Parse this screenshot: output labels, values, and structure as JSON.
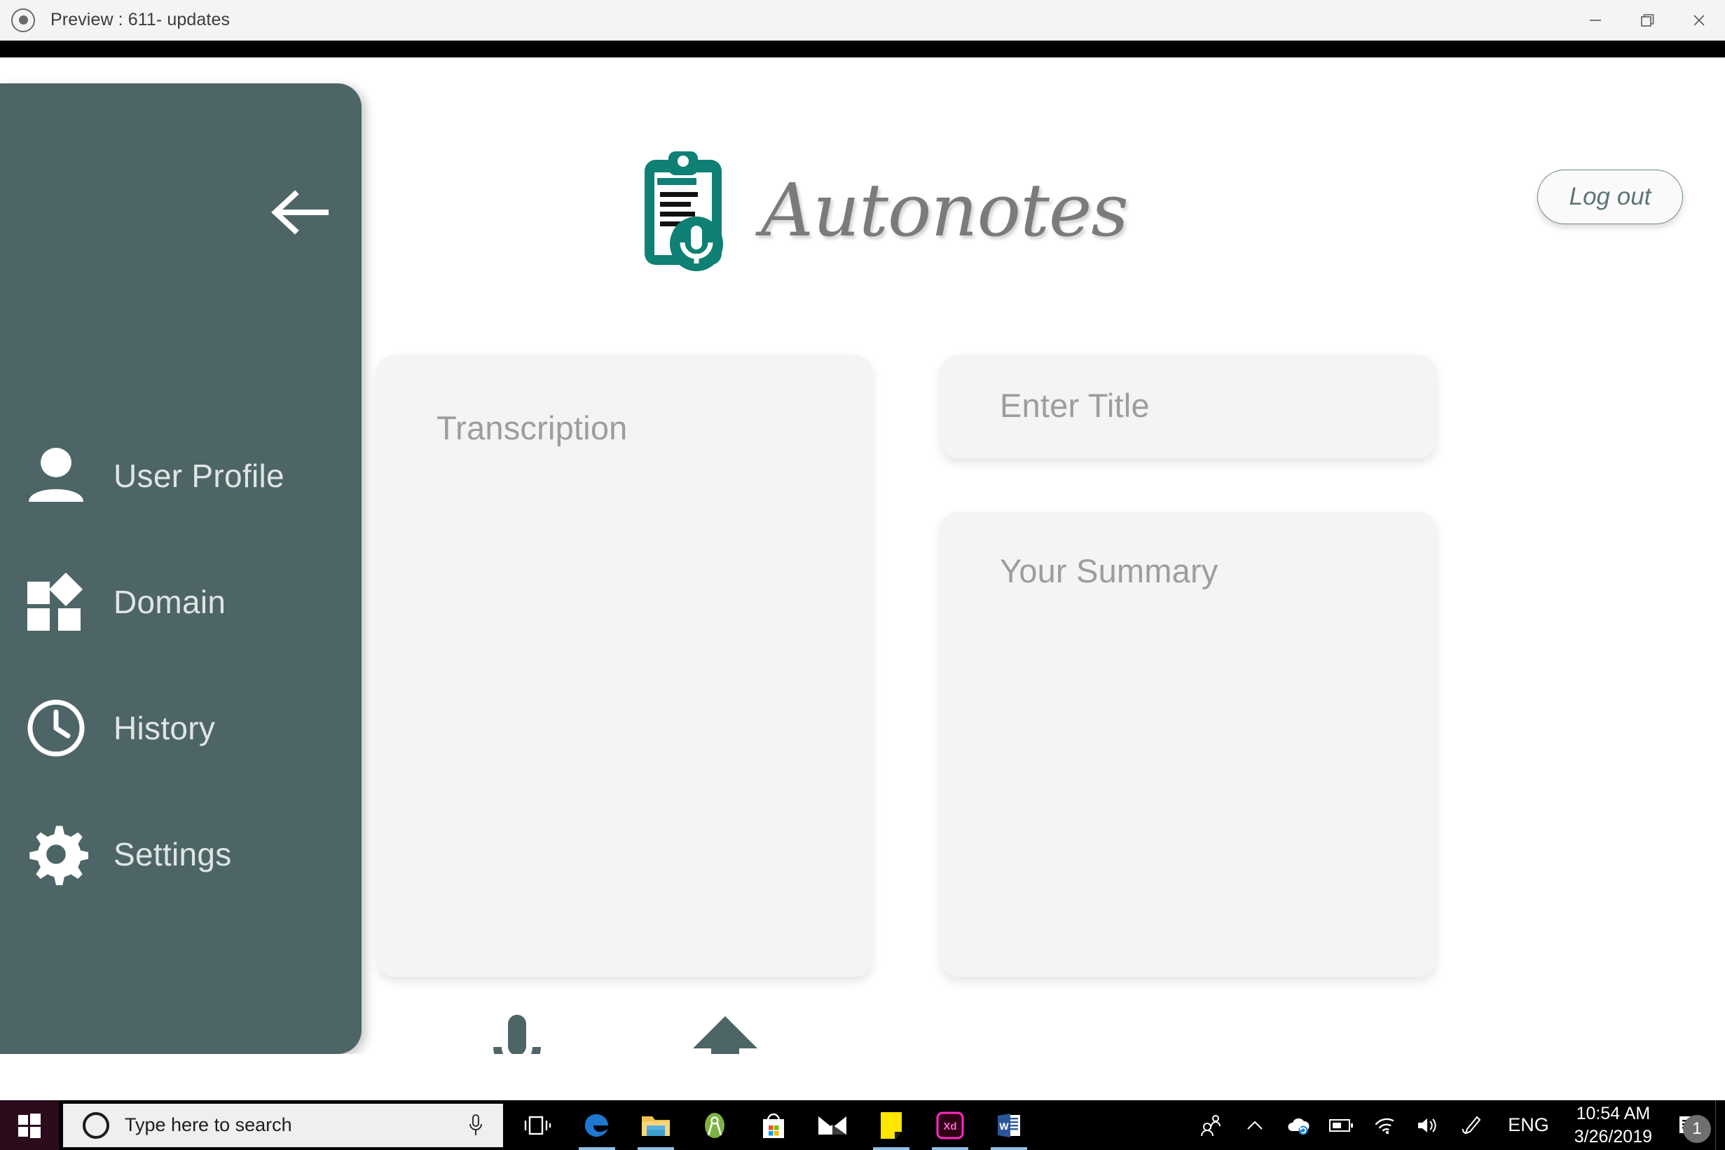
{
  "window": {
    "title": "Preview : 611- updates",
    "app_icon": "record-circle-icon",
    "minimize_label": "Minimize",
    "restore_label": "Restore",
    "close_label": "Close"
  },
  "app": {
    "brand": "Autonotes",
    "logo_icon": "clipboard-microphone-logo",
    "back_icon": "arrow-left-icon",
    "logout_label": "Log out",
    "accent_color": "#0E8074",
    "sidebar_color": "#4D6566",
    "card_color": "#F4F4F4"
  },
  "sidebar": {
    "items": [
      {
        "label": "User Profile",
        "icon": "user-icon"
      },
      {
        "label": "Domain",
        "icon": "shapes-icon"
      },
      {
        "label": "History",
        "icon": "clock-icon"
      },
      {
        "label": "Settings",
        "icon": "gear-icon"
      }
    ]
  },
  "main": {
    "transcription_placeholder": "Transcription",
    "transcription_value": "",
    "title_placeholder": "Enter Title",
    "title_value": "",
    "summary_placeholder": "Your Summary",
    "summary_value": "",
    "mic_icon": "microphone-icon",
    "upload_icon": "upload-icon"
  },
  "taskbar": {
    "start_icon": "windows-logo-icon",
    "search_placeholder": "Type here to search",
    "search_mic_icon": "microphone-icon",
    "cortana_icon": "cortana-circle-icon",
    "pinned": [
      {
        "name": "task-view-icon",
        "running": false
      },
      {
        "name": "edge-icon",
        "running": true
      },
      {
        "name": "file-explorer-icon",
        "running": true
      },
      {
        "name": "android-studio-icon",
        "running": false
      },
      {
        "name": "microsoft-store-icon",
        "running": false
      },
      {
        "name": "mail-icon",
        "running": false
      },
      {
        "name": "sticky-notes-icon",
        "running": true
      },
      {
        "name": "adobe-xd-icon",
        "running": true
      },
      {
        "name": "word-icon",
        "running": true
      }
    ],
    "tray": {
      "people_icon": "people-icon",
      "overflow_icon": "chevron-up-icon",
      "onedrive_icon": "onedrive-icon",
      "battery_icon": "battery-icon",
      "network_icon": "wifi-icon",
      "volume_icon": "speaker-icon",
      "pen_icon": "pen-icon",
      "language": "ENG",
      "time": "10:54 AM",
      "date": "3/26/2019",
      "notification_count": "1",
      "notification_icon": "notification-icon"
    }
  }
}
